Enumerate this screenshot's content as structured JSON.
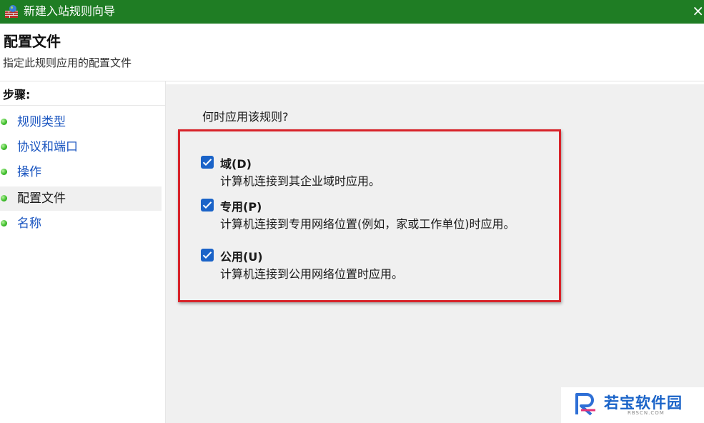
{
  "window": {
    "title": "新建入站规则向导",
    "close_glyph": "×",
    "icon": "firewall-icon"
  },
  "header": {
    "title": "配置文件",
    "subtitle": "指定此规则应用的配置文件"
  },
  "sidebar": {
    "heading": "步骤:",
    "items": [
      {
        "label": "规则类型",
        "active": false
      },
      {
        "label": "协议和端口",
        "active": false
      },
      {
        "label": "操作",
        "active": false
      },
      {
        "label": "配置文件",
        "active": true
      },
      {
        "label": "名称",
        "active": false
      }
    ]
  },
  "main": {
    "question": "何时应用该规则?",
    "options": [
      {
        "title": "域(D)",
        "description": "计算机连接到其企业域时应用。",
        "checked": true
      },
      {
        "title": "专用(P)",
        "description": "计算机连接到专用网络位置(例如，家或工作单位)时应用。",
        "checked": true
      },
      {
        "title": "公用(U)",
        "description": "计算机连接到公用网络位置时应用。",
        "checked": true
      }
    ]
  },
  "watermark": {
    "name": "若宝软件园",
    "site": "RBSCN.COM"
  },
  "colors": {
    "titlebar": "#1f7d24",
    "link": "#1a55c0",
    "checkbox": "#1a63c8",
    "highlight": "#d8232a"
  }
}
